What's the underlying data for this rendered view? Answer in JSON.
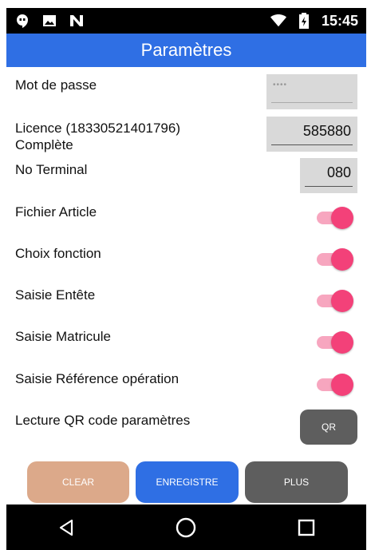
{
  "status_bar": {
    "time": "15:45",
    "left_icons": [
      "hangouts-icon",
      "image-icon",
      "n-logo-icon"
    ],
    "right_icons": [
      "wifi-icon",
      "battery-charging-icon"
    ]
  },
  "app_bar": {
    "title": "Paramètres",
    "color": "#2f6fe4"
  },
  "settings": {
    "password": {
      "label": "Mot de passe",
      "value": "••••"
    },
    "license": {
      "label": "Licence (18330521401796)",
      "status": "Complète",
      "value": "585880"
    },
    "terminal": {
      "label": "No Terminal",
      "value": "080"
    },
    "toggles": [
      {
        "label": "Fichier Article",
        "on": true
      },
      {
        "label": "Choix fonction",
        "on": true
      },
      {
        "label": "Saisie Entête",
        "on": true
      },
      {
        "label": "Saisie Matricule",
        "on": true
      },
      {
        "label": "Saisie Référence opération",
        "on": true
      }
    ],
    "qr": {
      "label": "Lecture QR code paramètres",
      "button": "QR"
    }
  },
  "actions": {
    "clear": "CLEAR",
    "save": "ENREGISTRE",
    "more": "PLUS"
  },
  "colors": {
    "clear": "#dca98a",
    "save": "#2f6fe4",
    "more": "#5e5e5e",
    "toggle_on": "#f34179"
  },
  "nav_bar": {
    "icons": [
      "back-icon",
      "home-icon",
      "recents-icon"
    ]
  }
}
